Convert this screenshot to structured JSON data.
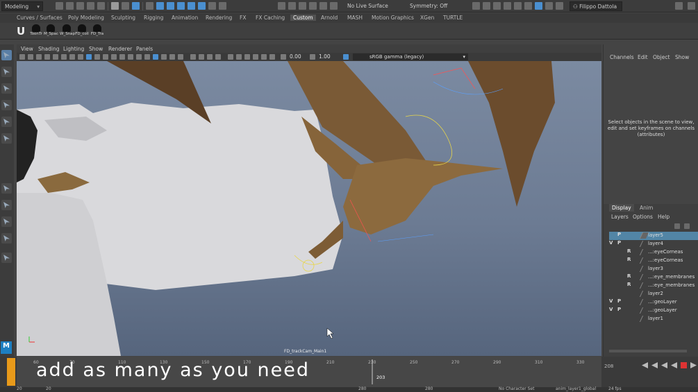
{
  "topbar": {
    "mode": "Modeling",
    "live_surface": "No Live Surface",
    "symmetry": "Symmetry: Off",
    "user": "Filippo Dattola"
  },
  "shelf_tabs": [
    "Curves / Surfaces",
    "Poly Modeling",
    "Sculpting",
    "Rigging",
    "Animation",
    "Rendering",
    "FX",
    "FX Caching",
    "Custom",
    "Arnold",
    "MASH",
    "Motion Graphics",
    "XGen",
    "TURTLE"
  ],
  "active_shelf_tab": "Custom",
  "shelf_buttons": [
    "ToonTr",
    "M_Spac",
    "W_Snap",
    "FD_coll",
    "FD_Tra"
  ],
  "viewport_menu": [
    "View",
    "Shading",
    "Lighting",
    "Show",
    "Renderer",
    "Panels"
  ],
  "viewport_toolbar": {
    "exposure": "0.00",
    "gamma": "1.00",
    "color_management": "sRGB gamma (legacy)"
  },
  "camera_label": "FD_trackCam_Main1",
  "channel_box": {
    "menu": [
      "Channels",
      "Edit",
      "Object",
      "Show"
    ],
    "message": "Select objects in the scene to view, edit and set keyframes on channels (attributes)"
  },
  "layer_editor": {
    "tabs": [
      "Display",
      "Anim"
    ],
    "menu": [
      "Layers",
      "Options",
      "Help"
    ],
    "layers": [
      {
        "v": "",
        "p": "P",
        "r": "",
        "name": "layer5",
        "selected": true,
        "indent": 0
      },
      {
        "v": "V",
        "p": "P",
        "r": "",
        "name": "layer4",
        "selected": false,
        "indent": 0
      },
      {
        "v": "",
        "p": "",
        "r": "R",
        "name": "...:eyeCorneas",
        "selected": false,
        "indent": 1
      },
      {
        "v": "",
        "p": "",
        "r": "R",
        "name": "...:eyeCorneas",
        "selected": false,
        "indent": 1
      },
      {
        "v": "",
        "p": "",
        "r": "",
        "name": "layer3",
        "selected": false,
        "indent": 0
      },
      {
        "v": "",
        "p": "",
        "r": "R",
        "name": "...:eye_membranes",
        "selected": false,
        "indent": 1
      },
      {
        "v": "",
        "p": "",
        "r": "R",
        "name": "...:eye_membranes",
        "selected": false,
        "indent": 1
      },
      {
        "v": "",
        "p": "",
        "r": "",
        "name": "layer2",
        "selected": false,
        "indent": 0
      },
      {
        "v": "V",
        "p": "P",
        "r": "",
        "name": "...:geoLayer",
        "selected": false,
        "indent": 1
      },
      {
        "v": "V",
        "p": "P",
        "r": "",
        "name": "...:geoLayer",
        "selected": false,
        "indent": 1
      },
      {
        "v": "",
        "p": "",
        "r": "",
        "name": "layer1",
        "selected": false,
        "indent": 0
      }
    ]
  },
  "timeline": {
    "ticks": [
      "60",
      "70",
      "110",
      "130",
      "150",
      "170",
      "190",
      "210",
      "230",
      "250",
      "270",
      "290",
      "310",
      "330"
    ],
    "current_frame": "203",
    "right_field": "208"
  },
  "subtitle": "add as many as you need",
  "range_bar": {
    "start": "20",
    "start2": "20",
    "end": "280",
    "end2": "280",
    "character_set": "No Character Set",
    "anim_layer": "anim_layer1_global",
    "fps": "24 fps"
  },
  "colors": {
    "selected_layer": "#5285a6",
    "accent": "#4a8fd0",
    "subtitle_marker": "#e89a1a"
  }
}
